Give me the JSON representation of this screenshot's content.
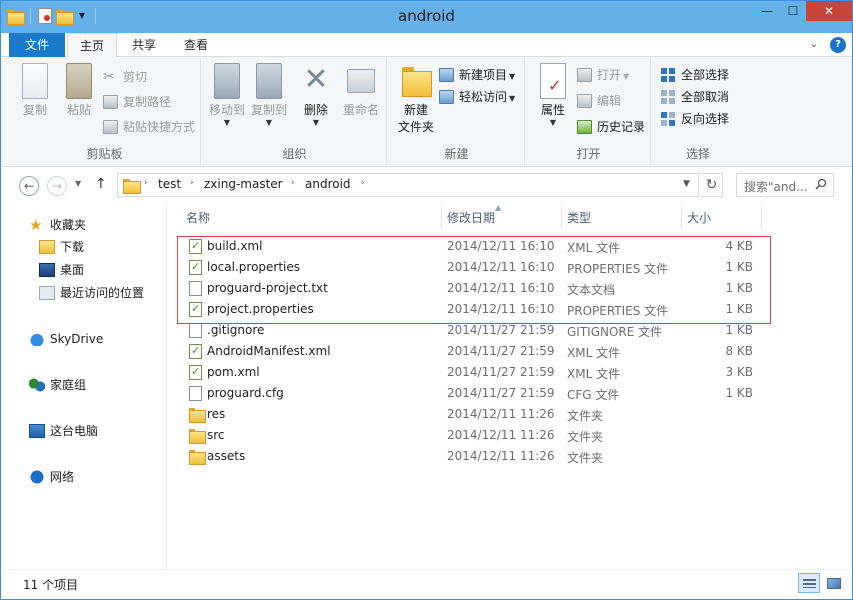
{
  "window": {
    "title": "android"
  },
  "tabs": {
    "file": "文件",
    "home": "主页",
    "share": "共享",
    "view": "查看"
  },
  "ribbon": {
    "clipboard": {
      "label": "剪贴板",
      "copy": "复制",
      "paste": "粘贴",
      "cut": "剪切",
      "copy_path": "复制路径",
      "paste_shortcut": "粘贴快捷方式"
    },
    "organize": {
      "label": "组织",
      "move_to": "移动到",
      "copy_to": "复制到",
      "delete": "删除",
      "rename": "重命名"
    },
    "new": {
      "label": "新建",
      "new_folder_line1": "新建",
      "new_folder_line2": "文件夹",
      "new_item": "新建项目",
      "easy_access": "轻松访问"
    },
    "open": {
      "label": "打开",
      "properties": "属性",
      "open": "打开",
      "edit": "编辑",
      "history": "历史记录"
    },
    "select": {
      "label": "选择",
      "select_all": "全部选择",
      "select_none": "全部取消",
      "invert": "反向选择"
    }
  },
  "address": {
    "crumbs": [
      "test",
      "zxing-master",
      "android"
    ],
    "search_placeholder": "搜索\"and...",
    "refresh_symbol": "↻"
  },
  "navpane": {
    "favorites": "收藏夹",
    "downloads": "下载",
    "desktop": "桌面",
    "recent": "最近访问的位置",
    "skydrive": "SkyDrive",
    "homegroup": "家庭组",
    "this_pc": "这台电脑",
    "network": "网络"
  },
  "columns": {
    "name": "名称",
    "date": "修改日期",
    "type": "类型",
    "size": "大小"
  },
  "files": [
    {
      "name": "build.xml",
      "date": "2014/12/11 16:10",
      "type": "XML 文件",
      "size": "4 KB",
      "icon": "xml-file-icon"
    },
    {
      "name": "local.properties",
      "date": "2014/12/11 16:10",
      "type": "PROPERTIES 文件",
      "size": "1 KB",
      "icon": "xml-file-icon"
    },
    {
      "name": "proguard-project.txt",
      "date": "2014/12/11 16:10",
      "type": "文本文档",
      "size": "1 KB",
      "icon": "text-file-icon"
    },
    {
      "name": "project.properties",
      "date": "2014/12/11 16:10",
      "type": "PROPERTIES 文件",
      "size": "1 KB",
      "icon": "xml-file-icon"
    },
    {
      "name": ".gitignore",
      "date": "2014/11/27 21:59",
      "type": "GITIGNORE 文件",
      "size": "1 KB",
      "icon": "text-file-icon"
    },
    {
      "name": "AndroidManifest.xml",
      "date": "2014/11/27 21:59",
      "type": "XML 文件",
      "size": "8 KB",
      "icon": "xml-file-icon"
    },
    {
      "name": "pom.xml",
      "date": "2014/11/27 21:59",
      "type": "XML 文件",
      "size": "3 KB",
      "icon": "xml-file-icon"
    },
    {
      "name": "proguard.cfg",
      "date": "2014/11/27 21:59",
      "type": "CFG 文件",
      "size": "1 KB",
      "icon": "text-file-icon"
    },
    {
      "name": "res",
      "date": "2014/12/11 11:26",
      "type": "文件夹",
      "size": "",
      "icon": "folder-icon"
    },
    {
      "name": "src",
      "date": "2014/12/11 11:26",
      "type": "文件夹",
      "size": "",
      "icon": "folder-icon"
    },
    {
      "name": "assets",
      "date": "2014/12/11 11:26",
      "type": "文件夹",
      "size": "",
      "icon": "folder-icon"
    }
  ],
  "status": {
    "count": "11 个项目"
  },
  "colors": {
    "accent": "#1979ca",
    "title_bar": "#64b1ea",
    "close": "#c7463b",
    "highlight_border": "#d9414a"
  }
}
